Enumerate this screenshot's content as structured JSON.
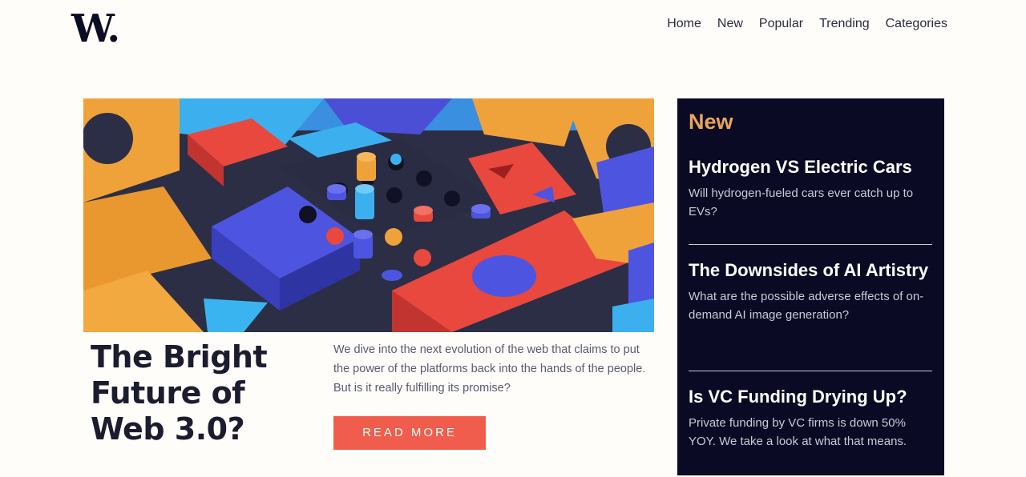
{
  "header": {
    "logo": "W.",
    "nav": [
      "Home",
      "New",
      "Popular",
      "Trending",
      "Categories"
    ]
  },
  "main": {
    "title": "The Bright Future of Web 3.0?",
    "description": "We dive into the next evolution of the web that claims to put the power of the platforms back into the hands of the people. But is it really fulfilling its promise?",
    "button": "READ MORE"
  },
  "sidebar": {
    "heading": "New",
    "items": [
      {
        "title": "Hydrogen VS Electric Cars",
        "description": "Will hydrogen-fueled cars ever catch up to EVs?"
      },
      {
        "title": "The Downsides of AI Artistry",
        "description": "What are the possible adverse effects of on-demand AI image generation?"
      },
      {
        "title": "Is VC Funding Drying Up?",
        "description": "Private funding by VC firms is down 50% YOY. We take a look at what that means."
      }
    ]
  },
  "colors": {
    "background": "#fffdf9",
    "accent": "#f15d4c",
    "sidebar_bg": "#0a0a24",
    "sidebar_heading": "#e9a55c"
  }
}
